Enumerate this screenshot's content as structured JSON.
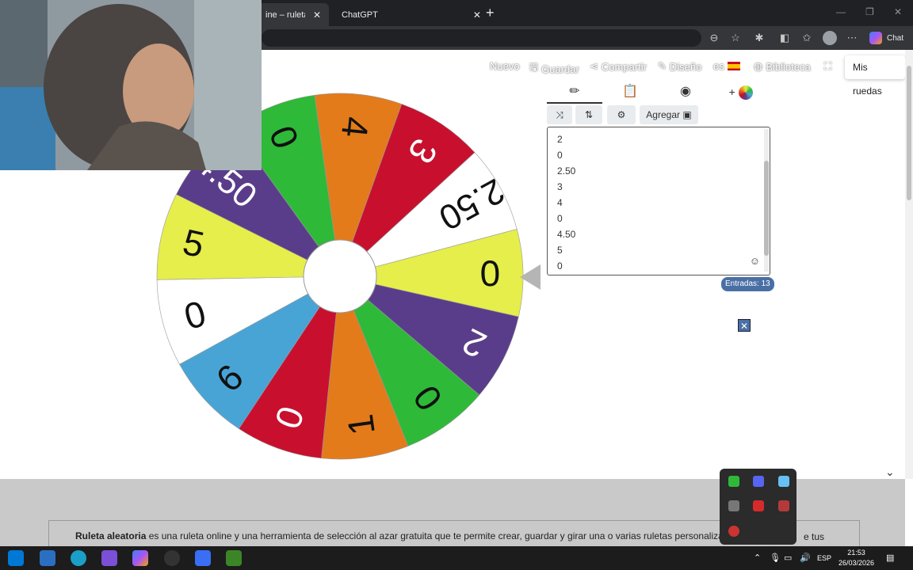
{
  "browser": {
    "tabs": [
      {
        "title": "ine – ruleta de",
        "active": true
      },
      {
        "title": "ChatGPT",
        "active": false
      }
    ],
    "copilot_label": "Chat"
  },
  "site_menu": {
    "nuevo": "Nuevo",
    "guardar": "Guardar",
    "compartir": "Compartir",
    "diseno": "Diseño",
    "language": "es",
    "biblioteca": "Biblioteca",
    "mis_ruedas": "Mis ruedas"
  },
  "wheel": {
    "segments": [
      {
        "label": "4",
        "color": "#e37b1b"
      },
      {
        "label": "3",
        "color": "#c8102e"
      },
      {
        "label": "2.50",
        "color": "#ffffff"
      },
      {
        "label": "0",
        "color": "#e5ee4b"
      },
      {
        "label": "2",
        "color": "#5a3d8a"
      },
      {
        "label": "0",
        "color": "#2fb939"
      },
      {
        "label": "1",
        "color": "#e37b1b"
      },
      {
        "label": "0",
        "color": "#c8102e"
      },
      {
        "label": "6",
        "color": "#49a4d6"
      },
      {
        "label": "0",
        "color": "#ffffff"
      },
      {
        "label": "5",
        "color": "#e5ee4b"
      },
      {
        "label": "4.50",
        "color": "#5a3d8a"
      },
      {
        "label": "0",
        "color": "#2fb939"
      }
    ]
  },
  "editor": {
    "tabs": [
      "edit-icon",
      "clipboard-icon",
      "eye-off-icon",
      "add-color-icon"
    ],
    "tools": {
      "agregar": "Agregar"
    },
    "entries": [
      "2",
      "0",
      "2.50",
      "3",
      "4",
      "0",
      "4.50",
      "5",
      "0"
    ],
    "count_label": "Entradas: 13"
  },
  "description": {
    "bold": "Ruleta aleatoria",
    "text": " es una ruleta online y una herramienta de selección al azar gratuita que te permite crear, guardar y girar una o varias ruletas personalizadas en una n",
    "tail": "e tus"
  },
  "taskbar": {
    "lang": "ESP",
    "time": "21:53",
    "date": "26/03/2026"
  }
}
